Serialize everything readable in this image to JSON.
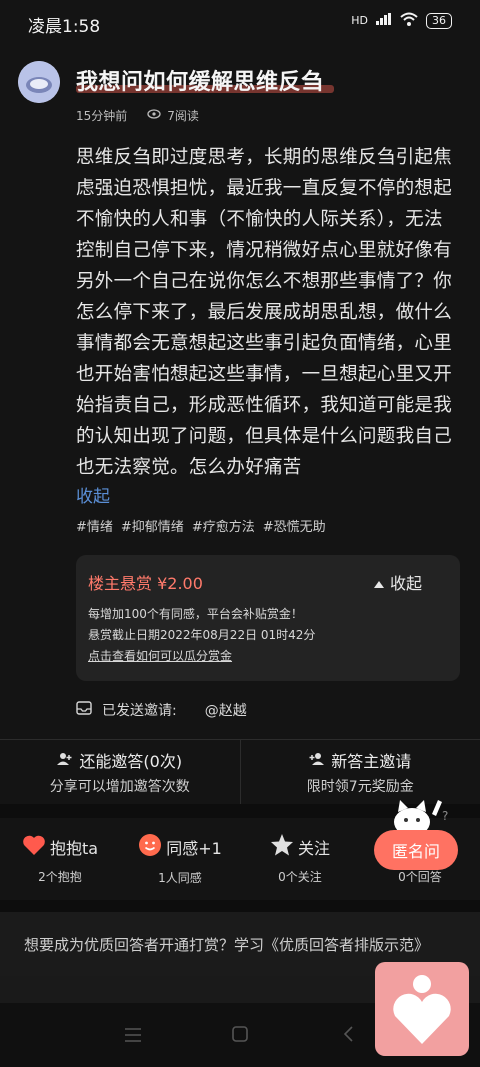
{
  "status_bar": {
    "time": "凌晨1:58",
    "network": "HD",
    "battery": "36"
  },
  "post": {
    "title": "我想问如何缓解思维反刍",
    "time_ago": "15分钟前",
    "reads": "7阅读",
    "body": "思维反刍即过度思考，长期的思维反刍引起焦虑强迫恐惧担忧，最近我一直反复不停的想起不愉快的人和事（不愉快的人际关系），无法控制自己停下来，情况稍微好点心里就好像有另外一个自己在说你怎么不想那些事情了？你怎么停下来了，最后发展成胡思乱想，做什么事情都会无意想起这些事引起负面情绪，心里也开始害怕想起这些事情，一旦想起心里又开始指责自己，形成恶性循环，我知道可能是我的认知出现了问题，但具体是什么问题我自己也无法察觉。怎么办好痛苦",
    "collapse_label": "收起",
    "tags": [
      "#情绪",
      "#抑郁情绪",
      "#疗愈方法",
      "#恐慌无助"
    ]
  },
  "bounty": {
    "amount_label": "楼主悬赏 ¥2.00",
    "toggle_label": "收起",
    "line1": "每增加100个有同感，平台会补贴赏金！",
    "line2": "悬赏截止日期2022年08月22日 01时42分",
    "link": "点击查看如何可以瓜分赏金"
  },
  "invite": {
    "label": "已发送邀请:",
    "user": "@赵越"
  },
  "invite_row": {
    "left_title": "还能邀答(0次)",
    "left_sub": "分享可以增加邀答次数",
    "right_title": "新答主邀请",
    "right_sub": "限时领7元奖励金"
  },
  "actions": [
    {
      "label": "抱抱ta",
      "count": "2个抱抱",
      "icon": "heart-icon",
      "color": "#ff5a4d"
    },
    {
      "label": "同感+1",
      "count": "1人同感",
      "icon": "smile-icon",
      "color": "#ff6a4d"
    },
    {
      "label": "关注",
      "count": "0个关注",
      "icon": "star-icon",
      "color": "#e0e0e0"
    },
    {
      "label": "",
      "count": "0个回答",
      "icon": "comment-icon",
      "color": "#bdbdbd"
    }
  ],
  "anon_button": "匿名问",
  "promo": "想要成为优质回答者开通打赏？学习《优质回答者排版示范》",
  "colors": {
    "accent": "#ff7262",
    "link": "#5b8fd6",
    "bg": "#141414"
  }
}
